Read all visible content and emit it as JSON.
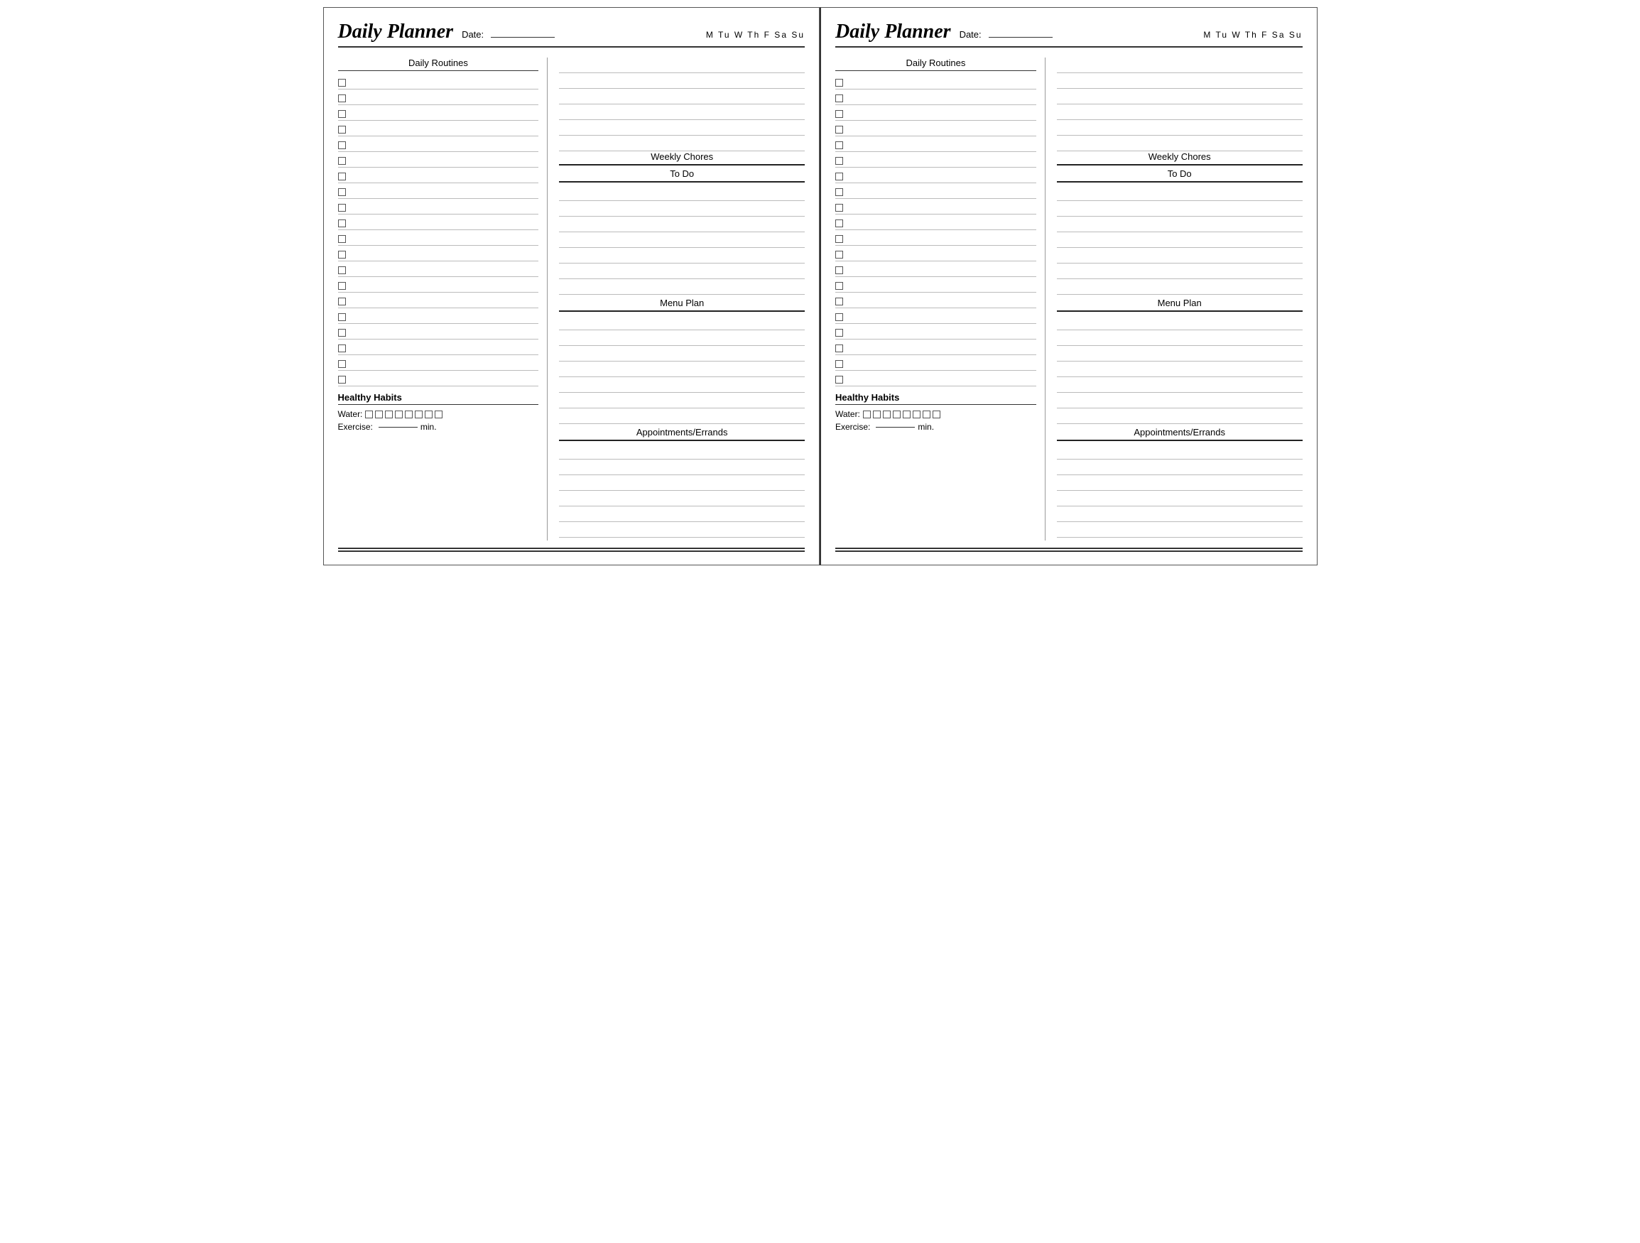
{
  "pages": [
    {
      "title": "Daily Planner",
      "date_label": "Date:",
      "days": "M  Tu  W  Th  F  Sa  Su",
      "left": {
        "section_header": "Daily Routines",
        "checkbox_count": 20
      },
      "right": {
        "sections": [
          {
            "name": "Weekly Chores",
            "lines_before": 6,
            "header": "Weekly Chores"
          },
          {
            "name": "To Do",
            "lines_before": 7,
            "header": "To Do"
          },
          {
            "name": "Menu Plan",
            "lines_before": 7,
            "header": "Menu Plan"
          },
          {
            "name": "Appointments/Errands",
            "lines_before": 6,
            "header": "Appointments/Errands"
          }
        ]
      },
      "healthy_habits": {
        "header": "Healthy Habits",
        "water_label": "Water:",
        "water_count": 8,
        "exercise_label": "Exercise:",
        "exercise_min": "min."
      }
    },
    {
      "title": "Daily Planner",
      "date_label": "Date:",
      "days": "M  Tu  W  Th  F  Sa  Su",
      "left": {
        "section_header": "Daily Routines",
        "checkbox_count": 20
      },
      "right": {
        "sections": [
          {
            "name": "Weekly Chores",
            "lines_before": 6,
            "header": "Weekly Chores"
          },
          {
            "name": "To Do",
            "lines_before": 7,
            "header": "To Do"
          },
          {
            "name": "Menu Plan",
            "lines_before": 7,
            "header": "Menu Plan"
          },
          {
            "name": "Appointments/Errands",
            "lines_before": 6,
            "header": "Appointments/Errands"
          }
        ]
      },
      "healthy_habits": {
        "header": "Healthy Habits",
        "water_label": "Water:",
        "water_count": 8,
        "exercise_label": "Exercise:",
        "exercise_min": "min."
      }
    }
  ]
}
